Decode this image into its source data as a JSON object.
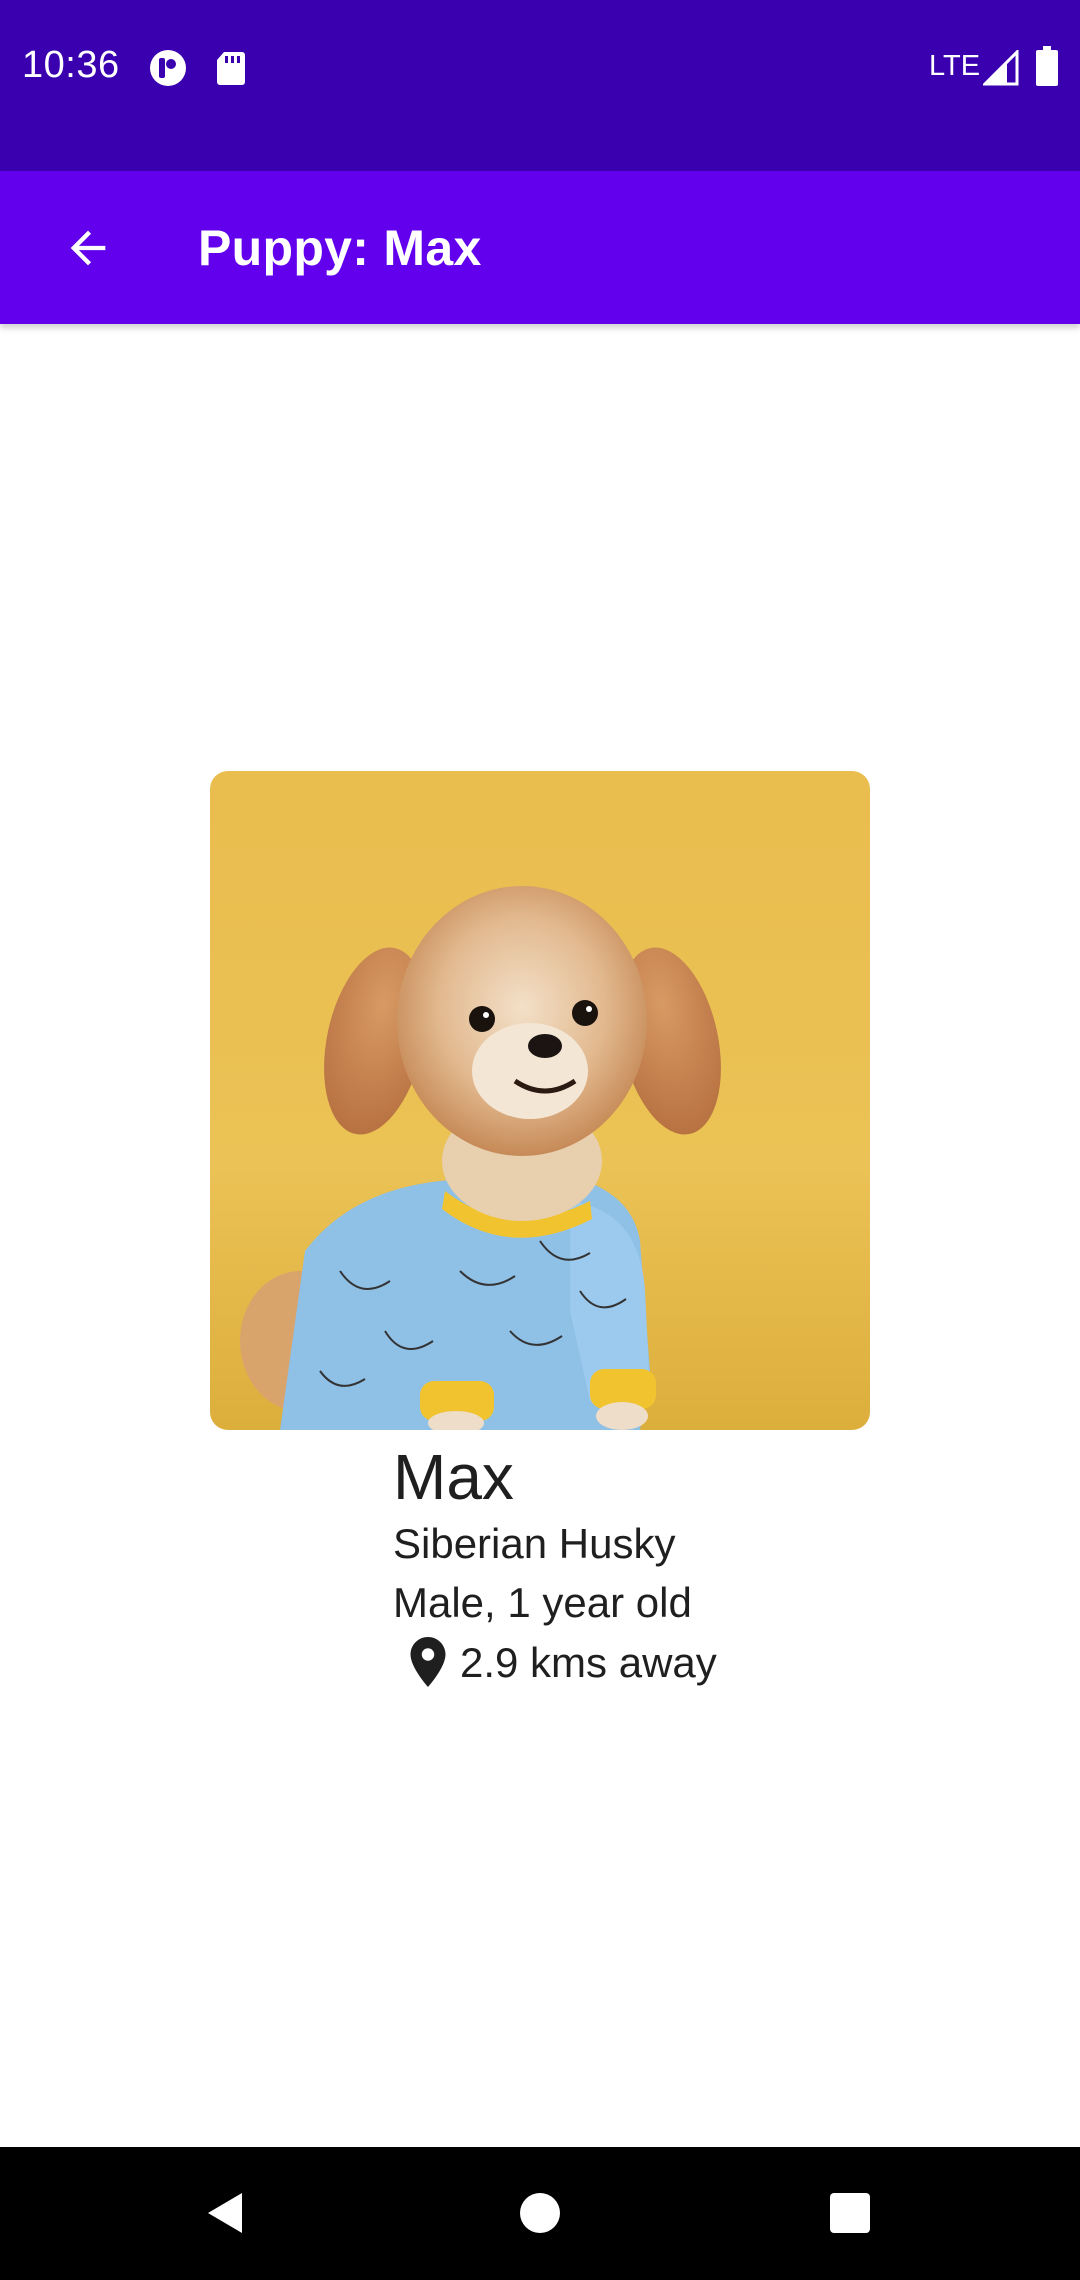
{
  "status_bar": {
    "time": "10:36",
    "network": "LTE",
    "background_color": "#3a00b0",
    "icons": [
      "pocket-casts-icon",
      "sd-card-icon",
      "signal-icon",
      "battery-icon"
    ]
  },
  "app_bar": {
    "title": "Puppy: Max",
    "background_color": "#6200ee",
    "back_icon": "arrow-back-icon"
  },
  "puppy": {
    "name": "Max",
    "breed": "Siberian Husky",
    "details": "Male, 1 year old",
    "distance": "2.9 kms away",
    "location_icon": "location-pin-icon",
    "photo": {
      "subject": "small fluffy dog in blue banana-print sweater",
      "background_color": "#ebbf4f"
    }
  },
  "nav_bar": {
    "buttons": [
      "back",
      "home",
      "recents"
    ]
  }
}
